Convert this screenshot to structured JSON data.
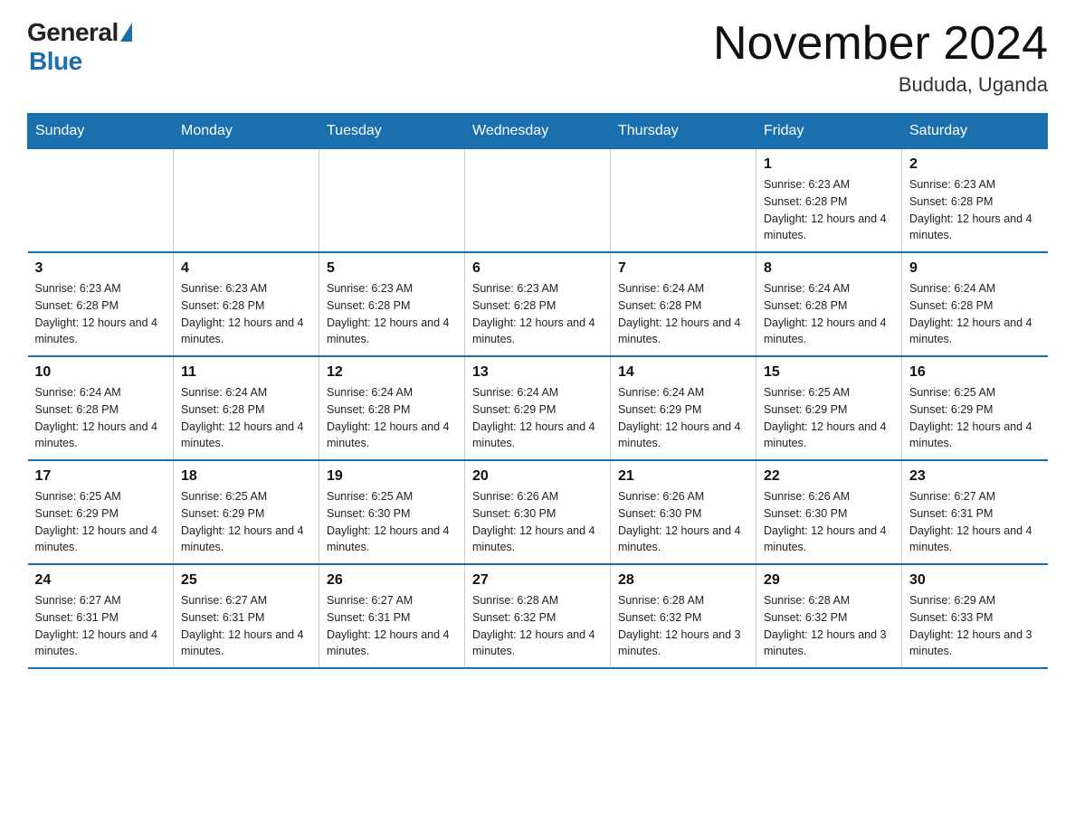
{
  "logo": {
    "general": "General",
    "blue": "Blue"
  },
  "header": {
    "title": "November 2024",
    "subtitle": "Bududa, Uganda"
  },
  "weekdays": [
    "Sunday",
    "Monday",
    "Tuesday",
    "Wednesday",
    "Thursday",
    "Friday",
    "Saturday"
  ],
  "rows": [
    [
      {
        "day": "",
        "sunrise": "",
        "sunset": "",
        "daylight": ""
      },
      {
        "day": "",
        "sunrise": "",
        "sunset": "",
        "daylight": ""
      },
      {
        "day": "",
        "sunrise": "",
        "sunset": "",
        "daylight": ""
      },
      {
        "day": "",
        "sunrise": "",
        "sunset": "",
        "daylight": ""
      },
      {
        "day": "",
        "sunrise": "",
        "sunset": "",
        "daylight": ""
      },
      {
        "day": "1",
        "sunrise": "Sunrise: 6:23 AM",
        "sunset": "Sunset: 6:28 PM",
        "daylight": "Daylight: 12 hours and 4 minutes."
      },
      {
        "day": "2",
        "sunrise": "Sunrise: 6:23 AM",
        "sunset": "Sunset: 6:28 PM",
        "daylight": "Daylight: 12 hours and 4 minutes."
      }
    ],
    [
      {
        "day": "3",
        "sunrise": "Sunrise: 6:23 AM",
        "sunset": "Sunset: 6:28 PM",
        "daylight": "Daylight: 12 hours and 4 minutes."
      },
      {
        "day": "4",
        "sunrise": "Sunrise: 6:23 AM",
        "sunset": "Sunset: 6:28 PM",
        "daylight": "Daylight: 12 hours and 4 minutes."
      },
      {
        "day": "5",
        "sunrise": "Sunrise: 6:23 AM",
        "sunset": "Sunset: 6:28 PM",
        "daylight": "Daylight: 12 hours and 4 minutes."
      },
      {
        "day": "6",
        "sunrise": "Sunrise: 6:23 AM",
        "sunset": "Sunset: 6:28 PM",
        "daylight": "Daylight: 12 hours and 4 minutes."
      },
      {
        "day": "7",
        "sunrise": "Sunrise: 6:24 AM",
        "sunset": "Sunset: 6:28 PM",
        "daylight": "Daylight: 12 hours and 4 minutes."
      },
      {
        "day": "8",
        "sunrise": "Sunrise: 6:24 AM",
        "sunset": "Sunset: 6:28 PM",
        "daylight": "Daylight: 12 hours and 4 minutes."
      },
      {
        "day": "9",
        "sunrise": "Sunrise: 6:24 AM",
        "sunset": "Sunset: 6:28 PM",
        "daylight": "Daylight: 12 hours and 4 minutes."
      }
    ],
    [
      {
        "day": "10",
        "sunrise": "Sunrise: 6:24 AM",
        "sunset": "Sunset: 6:28 PM",
        "daylight": "Daylight: 12 hours and 4 minutes."
      },
      {
        "day": "11",
        "sunrise": "Sunrise: 6:24 AM",
        "sunset": "Sunset: 6:28 PM",
        "daylight": "Daylight: 12 hours and 4 minutes."
      },
      {
        "day": "12",
        "sunrise": "Sunrise: 6:24 AM",
        "sunset": "Sunset: 6:28 PM",
        "daylight": "Daylight: 12 hours and 4 minutes."
      },
      {
        "day": "13",
        "sunrise": "Sunrise: 6:24 AM",
        "sunset": "Sunset: 6:29 PM",
        "daylight": "Daylight: 12 hours and 4 minutes."
      },
      {
        "day": "14",
        "sunrise": "Sunrise: 6:24 AM",
        "sunset": "Sunset: 6:29 PM",
        "daylight": "Daylight: 12 hours and 4 minutes."
      },
      {
        "day": "15",
        "sunrise": "Sunrise: 6:25 AM",
        "sunset": "Sunset: 6:29 PM",
        "daylight": "Daylight: 12 hours and 4 minutes."
      },
      {
        "day": "16",
        "sunrise": "Sunrise: 6:25 AM",
        "sunset": "Sunset: 6:29 PM",
        "daylight": "Daylight: 12 hours and 4 minutes."
      }
    ],
    [
      {
        "day": "17",
        "sunrise": "Sunrise: 6:25 AM",
        "sunset": "Sunset: 6:29 PM",
        "daylight": "Daylight: 12 hours and 4 minutes."
      },
      {
        "day": "18",
        "sunrise": "Sunrise: 6:25 AM",
        "sunset": "Sunset: 6:29 PM",
        "daylight": "Daylight: 12 hours and 4 minutes."
      },
      {
        "day": "19",
        "sunrise": "Sunrise: 6:25 AM",
        "sunset": "Sunset: 6:30 PM",
        "daylight": "Daylight: 12 hours and 4 minutes."
      },
      {
        "day": "20",
        "sunrise": "Sunrise: 6:26 AM",
        "sunset": "Sunset: 6:30 PM",
        "daylight": "Daylight: 12 hours and 4 minutes."
      },
      {
        "day": "21",
        "sunrise": "Sunrise: 6:26 AM",
        "sunset": "Sunset: 6:30 PM",
        "daylight": "Daylight: 12 hours and 4 minutes."
      },
      {
        "day": "22",
        "sunrise": "Sunrise: 6:26 AM",
        "sunset": "Sunset: 6:30 PM",
        "daylight": "Daylight: 12 hours and 4 minutes."
      },
      {
        "day": "23",
        "sunrise": "Sunrise: 6:27 AM",
        "sunset": "Sunset: 6:31 PM",
        "daylight": "Daylight: 12 hours and 4 minutes."
      }
    ],
    [
      {
        "day": "24",
        "sunrise": "Sunrise: 6:27 AM",
        "sunset": "Sunset: 6:31 PM",
        "daylight": "Daylight: 12 hours and 4 minutes."
      },
      {
        "day": "25",
        "sunrise": "Sunrise: 6:27 AM",
        "sunset": "Sunset: 6:31 PM",
        "daylight": "Daylight: 12 hours and 4 minutes."
      },
      {
        "day": "26",
        "sunrise": "Sunrise: 6:27 AM",
        "sunset": "Sunset: 6:31 PM",
        "daylight": "Daylight: 12 hours and 4 minutes."
      },
      {
        "day": "27",
        "sunrise": "Sunrise: 6:28 AM",
        "sunset": "Sunset: 6:32 PM",
        "daylight": "Daylight: 12 hours and 4 minutes."
      },
      {
        "day": "28",
        "sunrise": "Sunrise: 6:28 AM",
        "sunset": "Sunset: 6:32 PM",
        "daylight": "Daylight: 12 hours and 3 minutes."
      },
      {
        "day": "29",
        "sunrise": "Sunrise: 6:28 AM",
        "sunset": "Sunset: 6:32 PM",
        "daylight": "Daylight: 12 hours and 3 minutes."
      },
      {
        "day": "30",
        "sunrise": "Sunrise: 6:29 AM",
        "sunset": "Sunset: 6:33 PM",
        "daylight": "Daylight: 12 hours and 3 minutes."
      }
    ]
  ]
}
